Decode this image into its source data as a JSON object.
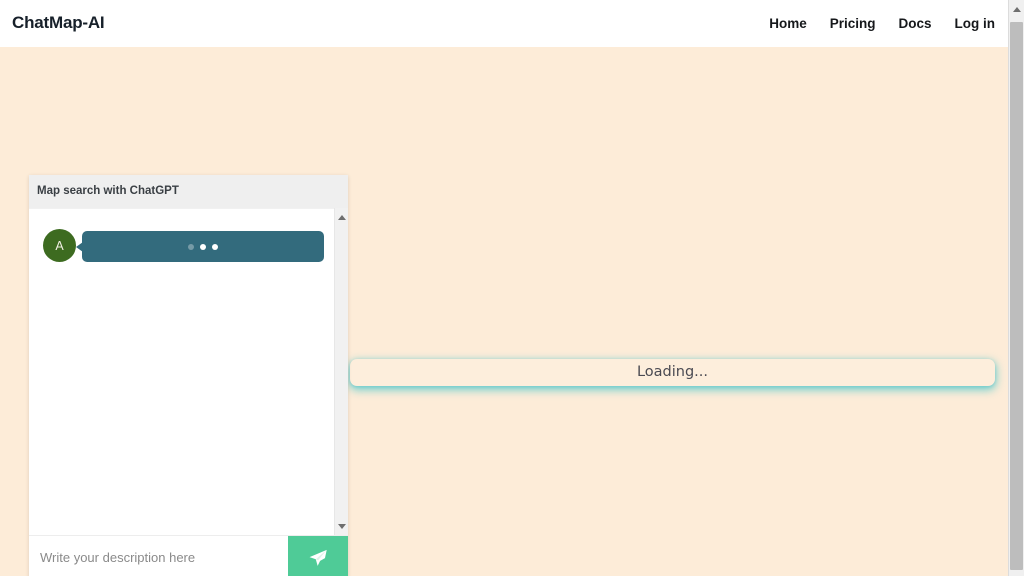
{
  "navbar": {
    "brand": "ChatMap-AI",
    "links": [
      {
        "label": "Home",
        "name": "nav-link-home"
      },
      {
        "label": "Pricing",
        "name": "nav-link-pricing"
      },
      {
        "label": "Docs",
        "name": "nav-link-docs"
      },
      {
        "label": "Log in",
        "name": "nav-link-login"
      }
    ]
  },
  "map": {
    "loading_text": "Loading...",
    "panel_bg": "#fdeedc",
    "glow_color": "#46c8cd"
  },
  "chat": {
    "header_title": "Map search with ChatGPT",
    "message": {
      "avatar_initial": "A",
      "avatar_color": "#3d6b20",
      "bubble_color": "#336b7d",
      "state": "typing",
      "dots": 3
    },
    "input": {
      "value": "",
      "placeholder": "Write your description here"
    },
    "send_button": {
      "icon": "paper-plane-icon",
      "color": "#4fcb97"
    },
    "scrollbar": {
      "up_arrow": "triangle-up-icon",
      "down_arrow": "triangle-down-icon"
    }
  },
  "window_scrollbar": {
    "up_arrow": "triangle-up-icon"
  },
  "theme": {
    "page_background": "#fdecd8",
    "navbar_background": "#ffffff",
    "card_background": "#ffffff",
    "card_header_background": "#efefef"
  }
}
